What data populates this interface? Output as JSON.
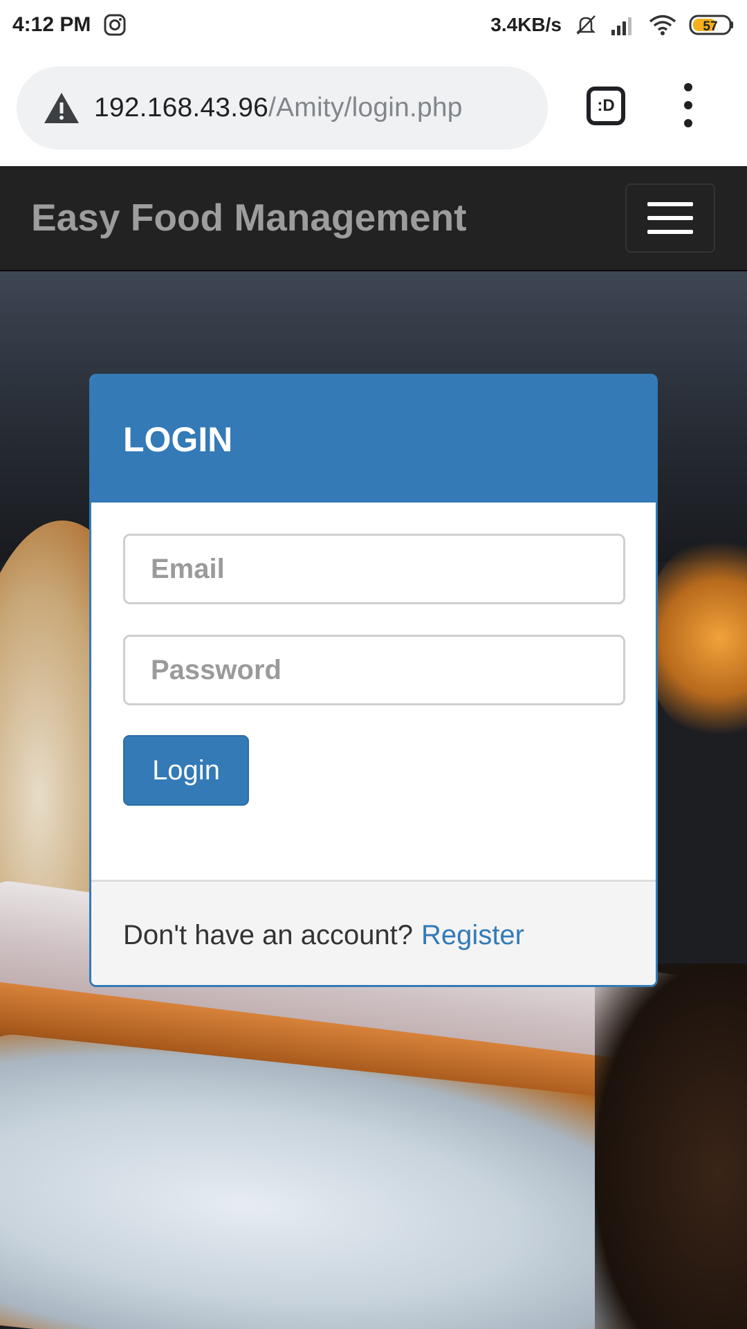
{
  "status_bar": {
    "time": "4:12 PM",
    "network_speed": "3.4KB/s",
    "battery": "57",
    "icons": [
      "instagram-icon",
      "mute-icon",
      "signal-icon",
      "wifi-icon",
      "battery-icon"
    ]
  },
  "browser": {
    "url_host": "192.168.43.96",
    "url_path": "/Amity/login.php",
    "tab_label": ":D"
  },
  "navbar": {
    "brand": "Easy Food Management"
  },
  "login_panel": {
    "title": "LOGIN",
    "email_placeholder": "Email",
    "password_placeholder": "Password",
    "login_button": "Login",
    "footer_text": "Don't have an account?",
    "register_link": "Register"
  },
  "colors": {
    "primary": "#337ab7",
    "navbar_bg": "#222222",
    "brand_text": "#9d9d9d"
  }
}
